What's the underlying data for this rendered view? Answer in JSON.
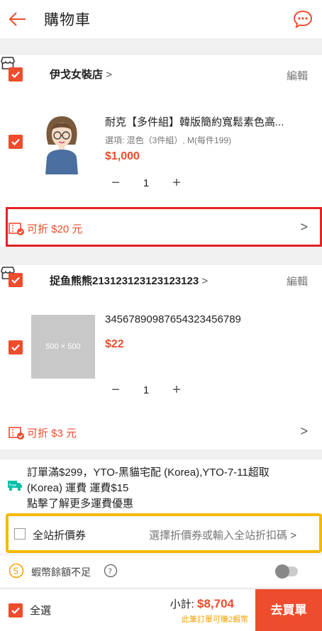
{
  "header": {
    "title": "購物車"
  },
  "shops": [
    {
      "name": "伊戈女裝店",
      "edit_label": "編輯",
      "item": {
        "name": "耐克【多件組】韓版簡約寬鬆素色高...",
        "option": "選項: 混色（3件組）, M(每件199)",
        "price": "$1,000",
        "qty": "1"
      },
      "discount": "可折 $20 元"
    },
    {
      "name": "捉鱼熊熊213123123123123123",
      "edit_label": "編輯",
      "item": {
        "name": "3456789098765432345678​9",
        "placeholder": "500 × 500",
        "price": "$22",
        "qty": "1"
      },
      "discount": "可折 $3 元"
    }
  ],
  "shipping": {
    "line1": "訂單滿$299，YTO-黑貓宅配 (Korea),YTO-7-11超取",
    "line2": "(Korea) 運費 運費$15",
    "line3": "點擊了解更多運費優惠"
  },
  "coupon": {
    "label": "全站折價券",
    "hint": "選擇折價券或輸入全站折扣碼"
  },
  "coins": {
    "label": "蝦幣餘額不足"
  },
  "bottom": {
    "select_all": "全選",
    "subtotal_label": "小計: ",
    "subtotal_value": "$8,704",
    "coins_note": "此筆訂單可賺2蝦幣",
    "checkout": "去買單"
  }
}
